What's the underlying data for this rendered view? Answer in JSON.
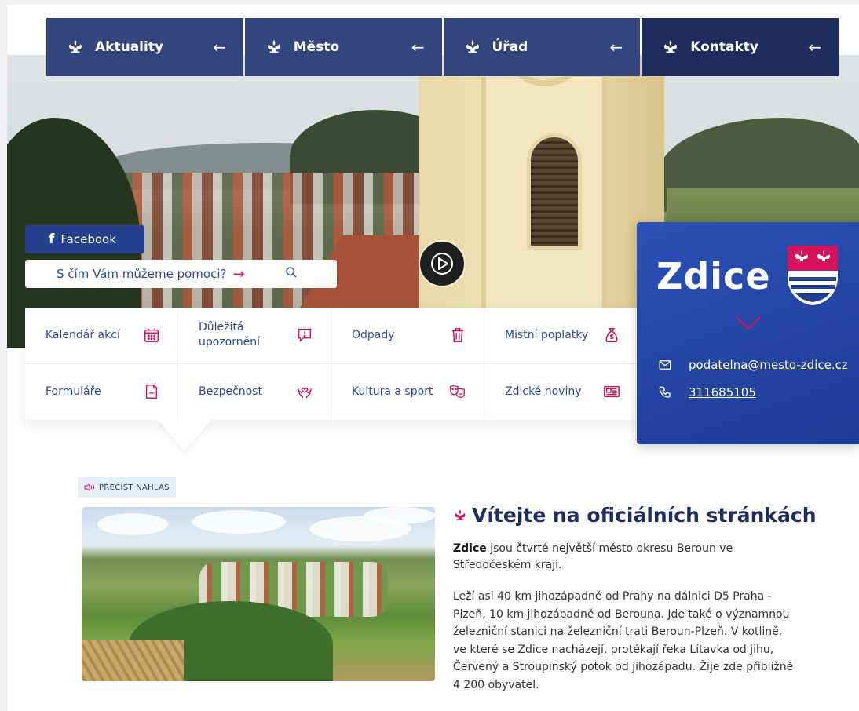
{
  "nav": [
    {
      "label": "Aktuality",
      "arrow": "←"
    },
    {
      "label": "Město",
      "arrow": "←"
    },
    {
      "label": "Úřad",
      "arrow": "←"
    },
    {
      "label": "Kontakty",
      "arrow": "←"
    }
  ],
  "facebook": {
    "icon": "f",
    "label": "Facebook"
  },
  "search": {
    "placeholder": "S čím Vám můžeme pomoci?",
    "arrow": "→"
  },
  "quick_links": [
    {
      "label": "Kalendář akcí",
      "icon": "calendar-icon"
    },
    {
      "label": "Důležitá upozornění",
      "icon": "alert-message-icon"
    },
    {
      "label": "Odpady",
      "icon": "trash-icon"
    },
    {
      "label": "Místní poplatky",
      "icon": "money-bag-icon"
    },
    {
      "label": "Formuláře",
      "icon": "document-icon"
    },
    {
      "label": "Bezpečnost",
      "icon": "hands-heart-icon"
    },
    {
      "label": "Kultura a sport",
      "icon": "theater-masks-icon"
    },
    {
      "label": "Zdické noviny",
      "icon": "newspaper-icon"
    }
  ],
  "town": {
    "name": "Zdice",
    "email": "podatelna@mesto-zdice.cz",
    "phone": "311685105"
  },
  "content": {
    "read_aloud": "PŘEČÍST NAHLAS",
    "heading": "Vítejte na oficiálních stránkách",
    "intro_bold": "Zdice",
    "intro_rest": " jsou čtvrté největší město okresu Beroun ve Středočeském kraji.",
    "paragraph": "Leží asi 40 km jihozápadně od Prahy na dálnici D5 Praha - Plzeň, 10 km jihozápadně od Berouna. Jde také o významnou železniční stanici na železniční trati Beroun-Plzeň. V kotlině, ve které se Zdice nacházejí, protékají řeka Litavka od jihu, Červený a Stroupinský potok od jihozápadu. Žije zde přibližně 4 200 obyvatel."
  },
  "colors": {
    "navy": "#32457d",
    "navy_dark": "#1d2d60",
    "panel_blue": "#2c51b8",
    "accent_pink": "#d4145a",
    "link_blue": "#2a4aa0"
  }
}
